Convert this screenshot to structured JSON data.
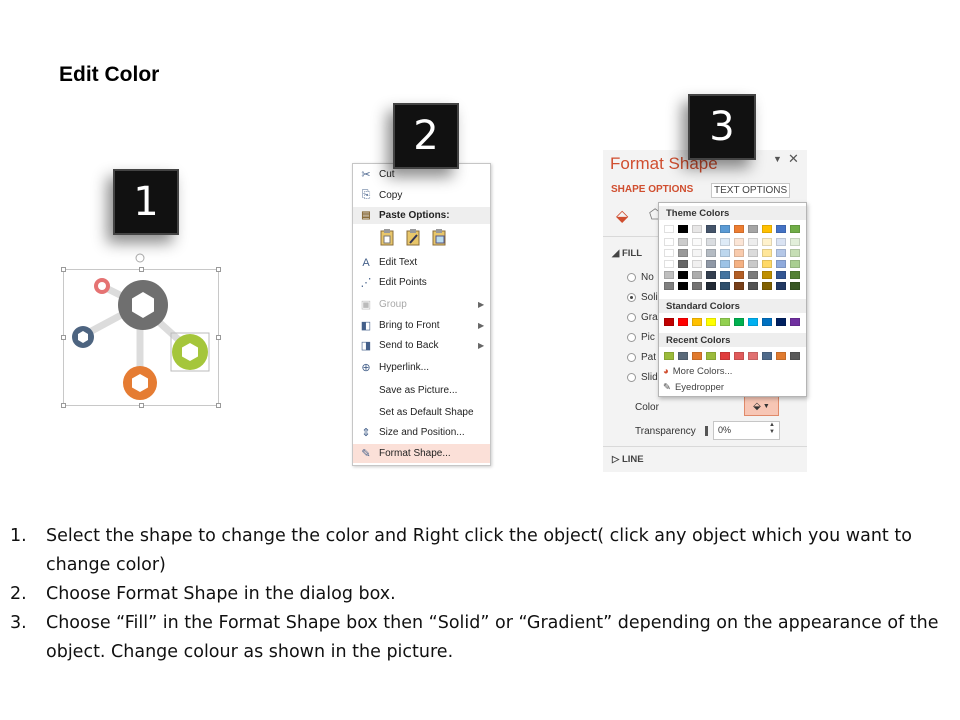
{
  "title": "Edit Color",
  "steps": [
    "1",
    "2",
    "3"
  ],
  "context_menu": {
    "items": [
      {
        "label": "Cut",
        "icon": "scissors-icon",
        "glyph": "✂"
      },
      {
        "label": "Copy",
        "icon": "copy-icon",
        "glyph": "⎘"
      },
      {
        "label": "Edit Text",
        "icon": "edit-text-icon",
        "glyph": "A"
      },
      {
        "label": "Edit Points",
        "icon": "edit-points-icon",
        "glyph": "⋰"
      },
      {
        "label": "Group",
        "icon": "group-icon",
        "glyph": "▣"
      },
      {
        "label": "Bring to Front",
        "icon": "bring-front-icon",
        "glyph": "◧"
      },
      {
        "label": "Send to Back",
        "icon": "send-back-icon",
        "glyph": "◨"
      },
      {
        "label": "Hyperlink...",
        "icon": "hyperlink-icon",
        "glyph": "⊕"
      },
      {
        "label": "Save as Picture...",
        "icon": "",
        "glyph": ""
      },
      {
        "label": "Set as Default Shape",
        "icon": "",
        "glyph": ""
      },
      {
        "label": "Size and Position...",
        "icon": "size-position-icon",
        "glyph": "⇕"
      },
      {
        "label": "Format Shape...",
        "icon": "format-shape-icon",
        "glyph": "✎"
      }
    ],
    "paste_options_label": "Paste Options:"
  },
  "format_pane": {
    "title": "Format Shape",
    "tab_shape": "SHAPE OPTIONS",
    "tab_text": "TEXT OPTIONS",
    "fill_label": "FILL",
    "fill_options": [
      "No",
      "Soli",
      "Gra",
      "Pic",
      "Pat",
      "Slid"
    ],
    "color_label": "Color",
    "transparency_label": "Transparency",
    "transparency_value": "0%",
    "line_label": "LINE",
    "palette": {
      "theme_header": "Theme Colors",
      "standard_header": "Standard Colors",
      "recent_header": "Recent Colors",
      "more_colors": "More Colors...",
      "eyedropper": "Eyedropper",
      "theme_colors": [
        "#ffffff",
        "#000000",
        "#e7e6e6",
        "#44546a",
        "#5b9bd5",
        "#ed7d31",
        "#a5a5a5",
        "#ffc000",
        "#4472c4",
        "#70ad47"
      ],
      "standard_colors": [
        "#c00000",
        "#ff0000",
        "#ffc000",
        "#ffff00",
        "#92d050",
        "#00b050",
        "#00b0f0",
        "#0070c0",
        "#002060",
        "#7030a0"
      ],
      "recent_colors": [
        "#9bbb3b",
        "#5a6a7a",
        "#e07a2e",
        "#9bbb3b",
        "#e03c3c",
        "#e05a5a",
        "#e07070",
        "#4f6a8a",
        "#e07a2e",
        "#5a5a5a"
      ]
    }
  },
  "instructions": [
    {
      "num": "1.",
      "text": "Select the shape to change the color and Right click the object( click any object which you want to change color)"
    },
    {
      "num": "2.",
      "text": "Choose Format Shape in the dialog box."
    },
    {
      "num": "3.",
      "text": "Choose “Fill” in the Format Shape box then “Solid” or “Gradient” depending on the appearance of the object. Change colour as shown in the picture."
    }
  ]
}
